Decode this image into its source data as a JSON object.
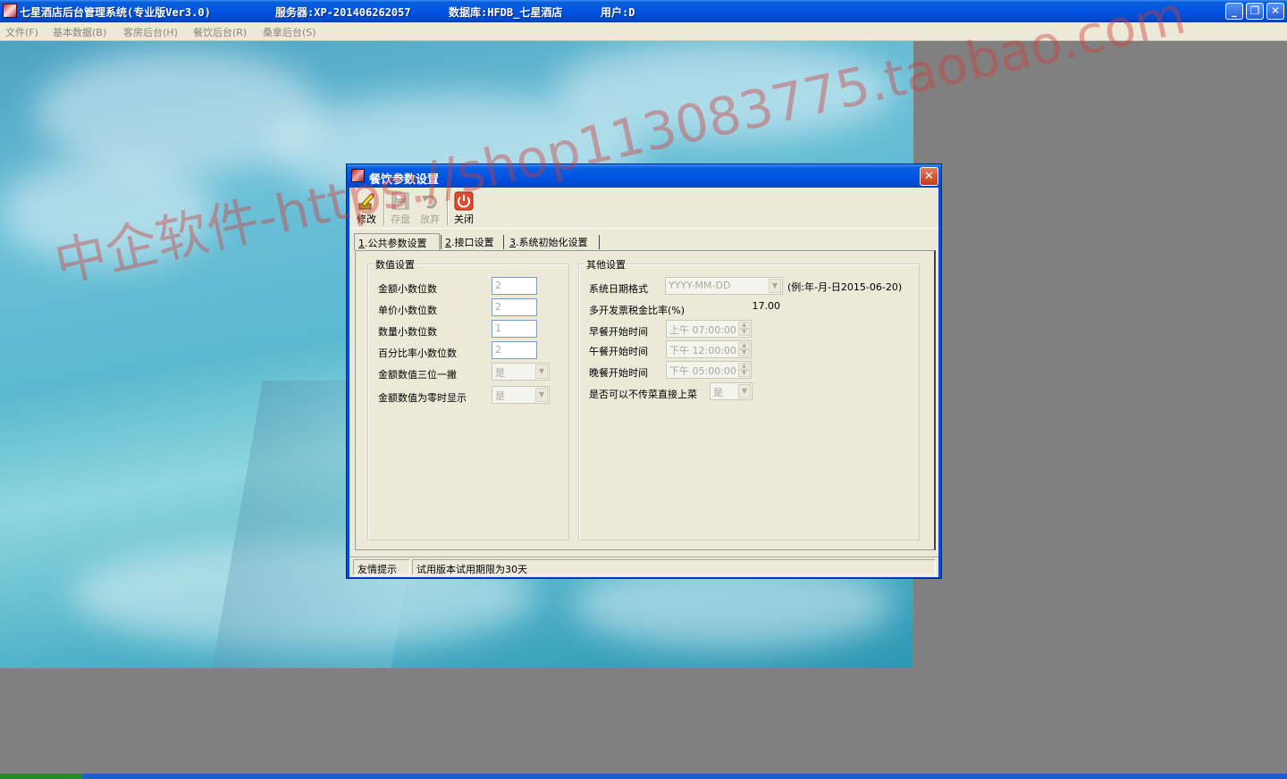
{
  "main_window": {
    "title": "七星酒店后台管理系统(专业版Ver3.0)",
    "server": "服务器:XP-201406262057",
    "database": "数据库:HFDB_七星酒店",
    "user": "用户:D",
    "minimize_glyph": "_",
    "restore_glyph": "❐",
    "close_glyph": "✕"
  },
  "menu": {
    "items": [
      "文件(F)",
      "基本数据(B)",
      "客房后台(H)",
      "餐饮后台(R)",
      "桑拿后台(S)"
    ]
  },
  "dialog": {
    "title": "餐饮参数设置",
    "close_glyph": "✕",
    "toolbar": {
      "edit": "修改",
      "save": "存盘",
      "discard": "放弃",
      "close": "关闭"
    },
    "tabs": [
      {
        "num": "1",
        "label": ".公共参数设置"
      },
      {
        "num": "2",
        "label": ".接口设置"
      },
      {
        "num": "3",
        "label": ".系统初始化设置"
      }
    ],
    "numeric_group": {
      "title": "数值设置",
      "amount_decimals": {
        "label": "金额小数位数",
        "value": "2"
      },
      "price_decimals": {
        "label": "单价小数位数",
        "value": "2"
      },
      "qty_decimals": {
        "label": "数量小数位数",
        "value": "1"
      },
      "percent_decimals": {
        "label": "百分比率小数位数",
        "value": "2"
      },
      "amount_thousands": {
        "label": "金额数值三位一撇",
        "value": "是"
      },
      "amount_zero_display": {
        "label": "金额数值为零时显示",
        "value": "是"
      }
    },
    "other_group": {
      "title": "其他设置",
      "date_format": {
        "label": "系统日期格式",
        "value": "YYYY-MM-DD",
        "hint": "(例:年-月-日2015-06-20)"
      },
      "invoice_tax": {
        "label": "多开发票税金比率(%)",
        "value": "17.00"
      },
      "breakfast": {
        "label": "早餐开始时间",
        "value": "上午 07:00:00"
      },
      "lunch": {
        "label": "午餐开始时间",
        "value": "下午 12:00:00"
      },
      "dinner": {
        "label": "晚餐开始时间",
        "value": "下午 05:00:00"
      },
      "serve_direct": {
        "label": "是否可以不传菜直接上菜",
        "value": "是"
      }
    },
    "status": {
      "label": "友情提示",
      "message": "试用版本试用期限为30天"
    }
  },
  "watermarks": {
    "left": "中企软件-https://shop113083775.taobao.com"
  }
}
